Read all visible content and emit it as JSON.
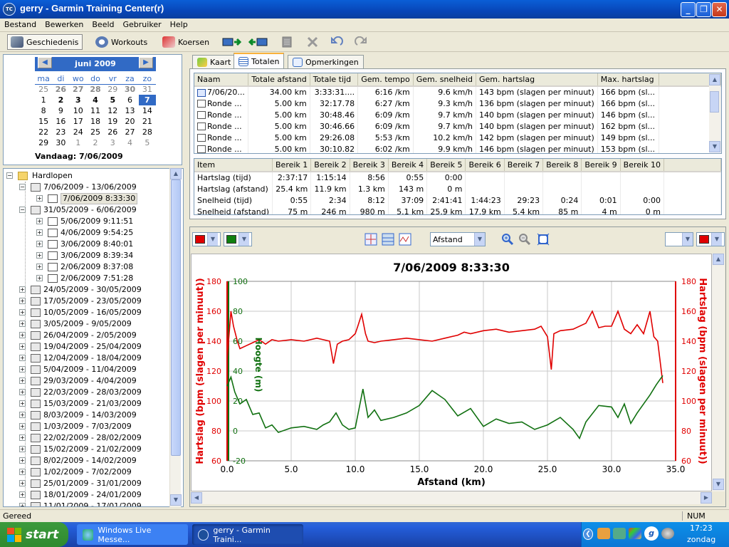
{
  "window": {
    "title": "gerry - Garmin Training Center(r)",
    "app_icon": "TC"
  },
  "menu": [
    "Bestand",
    "Bewerken",
    "Beeld",
    "Gebruiker",
    "Help"
  ],
  "toolbar": {
    "history": "Geschiedenis",
    "workouts": "Workouts",
    "courses": "Koersen"
  },
  "calendar": {
    "month": "juni 2009",
    "days": [
      "ma",
      "di",
      "wo",
      "do",
      "vr",
      "za",
      "zo"
    ],
    "weeks": [
      [
        {
          "d": "25",
          "o": 1
        },
        {
          "d": "26",
          "o": 1,
          "b": 1
        },
        {
          "d": "27",
          "o": 1,
          "b": 1
        },
        {
          "d": "28",
          "o": 1,
          "b": 1
        },
        {
          "d": "29",
          "o": 1
        },
        {
          "d": "30",
          "o": 1,
          "b": 1
        },
        {
          "d": "31",
          "o": 1
        }
      ],
      [
        {
          "d": "1"
        },
        {
          "d": "2",
          "b": 1
        },
        {
          "d": "3",
          "b": 1
        },
        {
          "d": "4",
          "b": 1
        },
        {
          "d": "5",
          "b": 1
        },
        {
          "d": "6"
        },
        {
          "d": "7",
          "s": 1
        }
      ],
      [
        {
          "d": "8"
        },
        {
          "d": "9"
        },
        {
          "d": "10"
        },
        {
          "d": "11"
        },
        {
          "d": "12"
        },
        {
          "d": "13"
        },
        {
          "d": "14"
        }
      ],
      [
        {
          "d": "15"
        },
        {
          "d": "16"
        },
        {
          "d": "17"
        },
        {
          "d": "18"
        },
        {
          "d": "19"
        },
        {
          "d": "20"
        },
        {
          "d": "21"
        }
      ],
      [
        {
          "d": "22"
        },
        {
          "d": "23"
        },
        {
          "d": "24"
        },
        {
          "d": "25"
        },
        {
          "d": "26"
        },
        {
          "d": "27"
        },
        {
          "d": "28"
        }
      ],
      [
        {
          "d": "29"
        },
        {
          "d": "30"
        },
        {
          "d": "1",
          "o": 1
        },
        {
          "d": "2",
          "o": 1
        },
        {
          "d": "3",
          "o": 1
        },
        {
          "d": "4",
          "o": 1
        },
        {
          "d": "5",
          "o": 1
        }
      ]
    ],
    "today": "Vandaag: 7/06/2009"
  },
  "tree": {
    "root": "Hardlopen",
    "items": [
      {
        "label": "7/06/2009 - 13/06/2009",
        "level": 1,
        "type": "week",
        "open": true
      },
      {
        "label": "7/06/2009 8:33:30",
        "level": 2,
        "type": "run",
        "selected": true
      },
      {
        "label": "31/05/2009 - 6/06/2009",
        "level": 1,
        "type": "week",
        "open": true
      },
      {
        "label": "5/06/2009 9:11:51",
        "level": 2,
        "type": "run"
      },
      {
        "label": "4/06/2009 9:54:25",
        "level": 2,
        "type": "run"
      },
      {
        "label": "3/06/2009 8:40:01",
        "level": 2,
        "type": "run"
      },
      {
        "label": "3/06/2009 8:39:34",
        "level": 2,
        "type": "run"
      },
      {
        "label": "2/06/2009 8:37:08",
        "level": 2,
        "type": "run"
      },
      {
        "label": "2/06/2009 7:51:28",
        "level": 2,
        "type": "run"
      },
      {
        "label": "24/05/2009 - 30/05/2009",
        "level": 1,
        "type": "week"
      },
      {
        "label": "17/05/2009 - 23/05/2009",
        "level": 1,
        "type": "week"
      },
      {
        "label": "10/05/2009 - 16/05/2009",
        "level": 1,
        "type": "week"
      },
      {
        "label": "3/05/2009 - 9/05/2009",
        "level": 1,
        "type": "week"
      },
      {
        "label": "26/04/2009 - 2/05/2009",
        "level": 1,
        "type": "week"
      },
      {
        "label": "19/04/2009 - 25/04/2009",
        "level": 1,
        "type": "week"
      },
      {
        "label": "12/04/2009 - 18/04/2009",
        "level": 1,
        "type": "week"
      },
      {
        "label": "5/04/2009 - 11/04/2009",
        "level": 1,
        "type": "week"
      },
      {
        "label": "29/03/2009 - 4/04/2009",
        "level": 1,
        "type": "week"
      },
      {
        "label": "22/03/2009 - 28/03/2009",
        "level": 1,
        "type": "week"
      },
      {
        "label": "15/03/2009 - 21/03/2009",
        "level": 1,
        "type": "week"
      },
      {
        "label": "8/03/2009 - 14/03/2009",
        "level": 1,
        "type": "week"
      },
      {
        "label": "1/03/2009 - 7/03/2009",
        "level": 1,
        "type": "week"
      },
      {
        "label": "22/02/2009 - 28/02/2009",
        "level": 1,
        "type": "week"
      },
      {
        "label": "15/02/2009 - 21/02/2009",
        "level": 1,
        "type": "week"
      },
      {
        "label": "8/02/2009 - 14/02/2009",
        "level": 1,
        "type": "week"
      },
      {
        "label": "1/02/2009 - 7/02/2009",
        "level": 1,
        "type": "week"
      },
      {
        "label": "25/01/2009 - 31/01/2009",
        "level": 1,
        "type": "week"
      },
      {
        "label": "18/01/2009 - 24/01/2009",
        "level": 1,
        "type": "week"
      },
      {
        "label": "11/01/2009 - 17/01/2009",
        "level": 1,
        "type": "week"
      }
    ]
  },
  "tabs": [
    {
      "label": "Kaart",
      "icon": "map-icon"
    },
    {
      "label": "Totalen",
      "icon": "table-icon",
      "active": true
    },
    {
      "label": "Opmerkingen",
      "icon": "notes-icon"
    }
  ],
  "laps": {
    "columns": [
      "Naam",
      "Totale afstand",
      "Totale tijd",
      "Gem. tempo",
      "Gem. snelheid",
      "Gem. hartslag",
      "Max. hartslag"
    ],
    "rows": [
      [
        "7/06/20...",
        "34.00 km",
        "3:33:31....",
        "6:16 /km",
        "9.6 km/h",
        "143 bpm (slagen per minuut)",
        "166 bpm (sl..."
      ],
      [
        "Ronde ...",
        "5.00 km",
        "32:17.78",
        "6:27 /km",
        "9.3 km/h",
        "136 bpm (slagen per minuut)",
        "166 bpm (sl..."
      ],
      [
        "Ronde ...",
        "5.00 km",
        "30:48.46",
        "6:09 /km",
        "9.7 km/h",
        "140 bpm (slagen per minuut)",
        "146 bpm (sl..."
      ],
      [
        "Ronde ...",
        "5.00 km",
        "30:46.66",
        "6:09 /km",
        "9.7 km/h",
        "140 bpm (slagen per minuut)",
        "162 bpm (sl..."
      ],
      [
        "Ronde ...",
        "5.00 km",
        "29:26.08",
        "5:53 /km",
        "10.2 km/h",
        "142 bpm (slagen per minuut)",
        "149 bpm (sl..."
      ],
      [
        "Ronde ...",
        "5.00 km",
        "30:10.82",
        "6:02 /km",
        "9.9 km/h",
        "146 bpm (slagen per minuut)",
        "153 bpm (sl..."
      ]
    ]
  },
  "zones": {
    "columns": [
      "Item",
      "Bereik 1",
      "Bereik 2",
      "Bereik 3",
      "Bereik 4",
      "Bereik 5",
      "Bereik 6",
      "Bereik 7",
      "Bereik 8",
      "Bereik 9",
      "Bereik 10"
    ],
    "rows": [
      [
        "Hartslag (tijd)",
        "2:37:17",
        "1:15:14",
        "8:56",
        "0:55",
        "0:00",
        "",
        "",
        "",
        "",
        ""
      ],
      [
        "Hartslag (afstand)",
        "25.4 km",
        "11.9 km",
        "1.3 km",
        "143 m",
        "0 m",
        "",
        "",
        "",
        "",
        ""
      ],
      [
        "Snelheid (tijd)",
        "0:55",
        "2:34",
        "8:12",
        "37:09",
        "2:41:41",
        "1:44:23",
        "29:23",
        "0:24",
        "0:01",
        "0:00"
      ],
      [
        "Snelheid (afstand)",
        "75 m",
        "246 m",
        "980 m",
        "5.1 km",
        "25.9 km",
        "17.9 km",
        "5.4 km",
        "85 m",
        "4 m",
        "0 m"
      ]
    ]
  },
  "chart_tools": {
    "axis_select": "Afstand",
    "left_color_1": "#e00000",
    "left_color_2": "#108010",
    "right_color": "#e00000"
  },
  "chart_data": {
    "type": "line",
    "title": "7/06/2009 8:33:30",
    "xlabel": "Afstand (km)",
    "ylabel_left": "Hartslag (bpm (slagen per minuut))",
    "ylabel_left_inner": "Hoogte (m)",
    "ylabel_right": "Hartslag (bpm (slagen per minuut))",
    "xlim": [
      0,
      35
    ],
    "x_ticks": [
      "0.0",
      "5.0",
      "10.0",
      "15.0",
      "20.0",
      "25.0",
      "30.0",
      "35.0"
    ],
    "ylim_hr": [
      60,
      180
    ],
    "hr_ticks": [
      "60",
      "80",
      "100",
      "120",
      "140",
      "160",
      "180"
    ],
    "ylim_alt": [
      -20,
      100
    ],
    "alt_ticks": [
      "-20",
      "0",
      "20",
      "40",
      "60",
      "80",
      "100"
    ],
    "grid": true,
    "series": [
      {
        "color": "#e00000",
        "axis": "hr",
        "x": [
          0,
          0.3,
          0.5,
          0.8,
          1,
          1.5,
          2,
          2.5,
          3,
          3.5,
          4,
          5,
          6,
          7,
          7.5,
          8,
          8.3,
          8.6,
          9,
          9.5,
          10,
          10.2,
          10.5,
          10.8,
          11,
          11.5,
          12,
          13,
          14,
          15,
          16,
          17,
          18,
          18.5,
          19,
          20,
          21,
          22,
          23,
          24,
          24.5,
          25,
          25.3,
          25.5,
          26,
          27,
          28,
          28.5,
          29,
          29.5,
          30,
          30.5,
          31,
          31.5,
          32,
          32.5,
          33,
          33.3,
          33.6,
          34
        ],
        "y": [
          128,
          160,
          150,
          140,
          135,
          137,
          139,
          141,
          138,
          141,
          140,
          141,
          140,
          142,
          141,
          140,
          125,
          138,
          140,
          141,
          145,
          150,
          158,
          145,
          140,
          139,
          140,
          141,
          142,
          141,
          140,
          142,
          144,
          146,
          145,
          147,
          148,
          146,
          147,
          148,
          150,
          143,
          121,
          145,
          147,
          148,
          152,
          160,
          149,
          150,
          150,
          160,
          148,
          145,
          151,
          145,
          160,
          143,
          140,
          112
        ]
      },
      {
        "color": "#107010",
        "axis": "alt",
        "x": [
          0,
          0.3,
          0.6,
          1,
          1.5,
          2,
          2.5,
          3,
          3.5,
          4,
          5,
          6,
          7,
          7.5,
          8,
          8.5,
          9,
          9.5,
          10,
          10.3,
          10.6,
          11,
          11.5,
          12,
          13,
          14,
          15,
          16,
          17,
          18,
          19,
          20,
          21,
          22,
          23,
          24,
          25,
          26,
          27,
          27.5,
          28,
          29,
          30,
          30.5,
          31,
          31.5,
          32,
          33,
          33.5,
          34
        ],
        "y": [
          30,
          36,
          26,
          18,
          21,
          11,
          12,
          2,
          4,
          -1,
          2,
          3,
          1,
          4,
          6,
          12,
          4,
          1,
          2,
          15,
          28,
          9,
          14,
          7,
          9,
          12,
          17,
          27,
          21,
          10,
          15,
          3,
          8,
          5,
          6,
          1,
          4,
          9,
          1,
          -5,
          6,
          17,
          16,
          9,
          18,
          5,
          12,
          24,
          31,
          37
        ]
      }
    ]
  },
  "status": {
    "left": "Gereed",
    "num": "NUM"
  },
  "taskbar": {
    "start": "start",
    "tasks": [
      {
        "label": "Windows Live Messe...",
        "active": false
      },
      {
        "label": "gerry - Garmin Traini...",
        "active": true
      }
    ],
    "time": "17:23",
    "day": "zondag"
  }
}
